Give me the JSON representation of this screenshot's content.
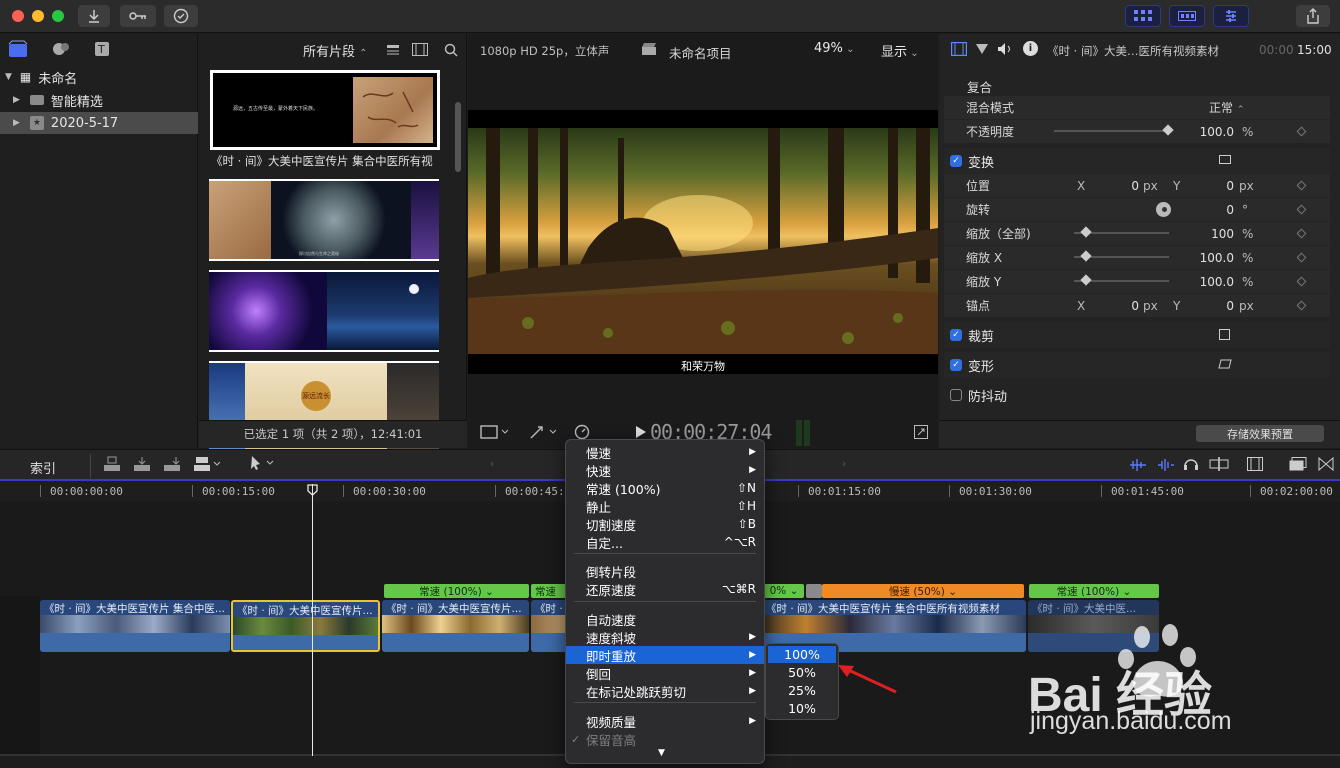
{
  "library": {
    "root": "未命名",
    "items": [
      "智能精选",
      "2020-5-17"
    ]
  },
  "browser": {
    "filter": "所有片段",
    "clip_caption": "《时 · 间》大美中医宣传片 集合中医所有视",
    "status": "已选定 1 项（共 2 项），12:41:01",
    "thumb1_text": "源远，五古传至最，蒙外着天下民族。",
    "thumb2_text": "探讨自然与生命之奥秘",
    "thumb4_text": "源远流长"
  },
  "viewer": {
    "format": "1080p HD 25p，立体声",
    "project": "未命名项目",
    "zoom": "49%",
    "display": "显示",
    "subtitle": "和荣万物",
    "timecode": "00:00:27:04"
  },
  "inspector": {
    "title": "《时 · 间》大美…医所有视频素材",
    "duration_prefix": "00:00",
    "duration": "15:00",
    "composite": "复合",
    "blend_label": "混合模式",
    "blend_value": "正常",
    "opacity_label": "不透明度",
    "opacity_value": "100.0",
    "opacity_level": 1.0,
    "transform": "变换",
    "position_label": "位置",
    "rotation_label": "旋转",
    "rotation_value": "0",
    "rotation_unit": "°",
    "scale_all_label": "缩放（全部)",
    "scale_all_value": "100",
    "scale_x_label": "缩放 X",
    "scale_x_value": "100.0",
    "scale_y_label": "缩放 Y",
    "scale_y_value": "100.0",
    "anchor_label": "锚点",
    "x_label": "X",
    "y_label": "Y",
    "zero": "0",
    "px": "px",
    "pct": "%",
    "crop": "裁剪",
    "distort": "变形",
    "stabilize": "防抖动",
    "save_preset": "存储效果预置"
  },
  "timeline": {
    "index_label": "索引",
    "ruler": [
      "00:00:00:00",
      "00:00:15:00",
      "00:00:30:00",
      "00:00:45:00",
      "00:01:00:00",
      "00:01:15:00",
      "00:01:30:00",
      "00:01:45:00",
      "00:02:00:00"
    ],
    "clip_title": "《时 · 间》大美中医宣传片 集合中医...",
    "clip_title_short": "《时 · 间》大美中医宣传片...",
    "clip_title_long": "《时 · 间》大美中医宣传片 集合中医所有视频素材",
    "clip_title_tiny": "《时 · 间》大...",
    "clip_title_mini": "《时 · 间》大美中医...",
    "speed_normal": "常速 (100%) ⌄",
    "speed_normal_short": "常速",
    "speed_normal_tiny": "0% ⌄",
    "speed_slow": "慢速 (50%) ⌄"
  },
  "menu": {
    "items": [
      {
        "label": "慢速",
        "key": "▶"
      },
      {
        "label": "快速",
        "key": "▶"
      },
      {
        "label": "常速 (100%)",
        "key": "⇧N"
      },
      {
        "label": "静止",
        "key": "⇧H"
      },
      {
        "label": "切割速度",
        "key": "⇧B"
      },
      {
        "label": "自定...",
        "key": "^⌥R"
      },
      {
        "label": "倒转片段",
        "key": ""
      },
      {
        "label": "还原速度",
        "key": "⌥⌘R"
      },
      {
        "label": "自动速度",
        "key": ""
      },
      {
        "label": "速度斜坡",
        "key": "▶"
      },
      {
        "label": "即时重放",
        "key": "▶"
      },
      {
        "label": "倒回",
        "key": "▶"
      },
      {
        "label": "在标记处跳跃剪切",
        "key": "▶"
      },
      {
        "label": "视频质量",
        "key": "▶"
      },
      {
        "label": "保留音高",
        "key": "✓"
      }
    ],
    "submenu": [
      "100%",
      "50%",
      "25%",
      "10%"
    ]
  },
  "watermark": {
    "brand": "Bai 经验",
    "url": "jingyan.baidu.com"
  }
}
